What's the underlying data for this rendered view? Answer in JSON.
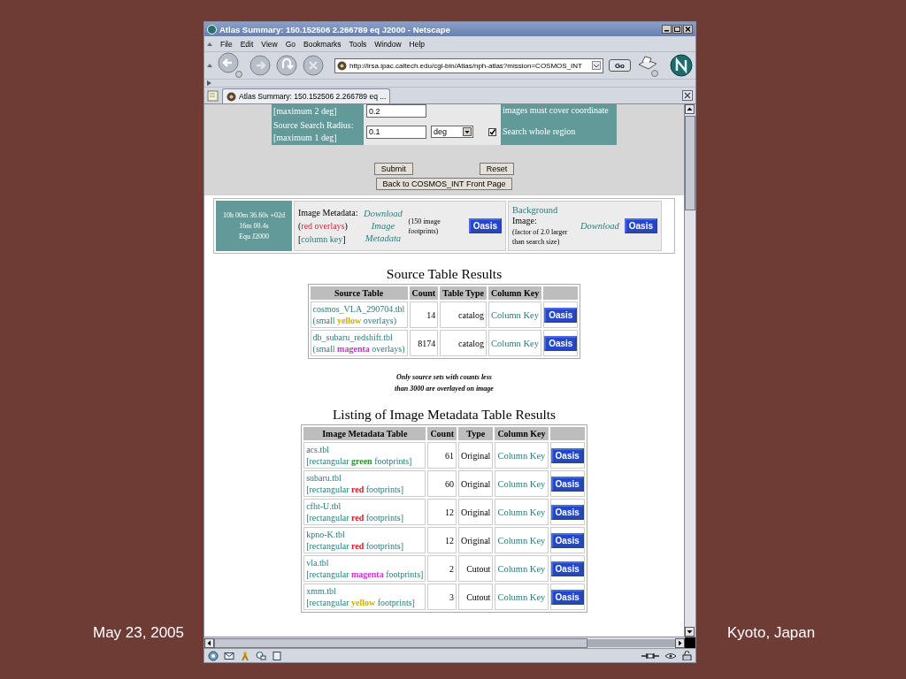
{
  "slide": {
    "date": "May 23, 2005",
    "place": "Kyoto, Japan"
  },
  "window": {
    "title": "Atlas Summary: 150.152506 2.266789 eq J2000 - Netscape",
    "menu": [
      "File",
      "Edit",
      "View",
      "Go",
      "Bookmarks",
      "Tools",
      "Window",
      "Help"
    ],
    "address": "http://irsa.ipac.caltech.edu/cgi-bin/Atlas/nph-atlas?mission=COSMOS_INT",
    "go": "Go",
    "tab": "Atlas Summary: 150.152506 2.266789 eq ..."
  },
  "search_form": {
    "rows": [
      {
        "label_lines": [
          "[maximum 2 deg]"
        ],
        "value": "0.2",
        "note": "images must cover coordinate"
      },
      {
        "label_lines": [
          "Source Search Radius:",
          "[maximum 1 deg]"
        ],
        "value": "0.1",
        "unit": "deg",
        "checked": true,
        "note": "Search whole region"
      }
    ],
    "buttons": [
      "Submit",
      "Reset"
    ],
    "back_button": "Back to COSMOS_INT Front Page"
  },
  "position": {
    "coordinates": "10h 00m 36.60s +02d 16m 00.4s",
    "system": "Equ J2000"
  },
  "image_metadata": {
    "label": "Image Metadata:",
    "overlay": [
      "(",
      "red overlays",
      ")"
    ],
    "column_key": [
      "[",
      "column key",
      "]"
    ],
    "download": "Download Image Metadata",
    "footprints": "(150 image footprints)",
    "oasis": "Oasis"
  },
  "background": {
    "link": "Background",
    "label": "Image:",
    "note": "(factor of 2.0 larger than search size)",
    "download": "Download",
    "oasis": "Oasis"
  },
  "source_table": {
    "title": "Source Table Results",
    "columns": [
      "Source Table",
      "Count",
      "Table Type",
      "Column Key"
    ],
    "rows": [
      {
        "name": "cosmos_VLA_290704.tbl",
        "note": "(small **yellow** overlays)",
        "color": "#c8b400",
        "count": "14",
        "type": "catalog",
        "column_key": "Column Key",
        "oasis": "Oasis"
      },
      {
        "name": "db_subaru_redshift.tbl",
        "note": "(small **magenta** overlays)",
        "color": "#cc33cc",
        "count": "8174",
        "type": "catalog",
        "column_key": "Column Key",
        "oasis": "Oasis"
      }
    ]
  },
  "overlay_note": [
    "Only source sets with counts less",
    "than 3000 are overlayed on image"
  ],
  "metadata_table": {
    "title": "Listing of Image Metadata Table Results",
    "columns": [
      "Image Metadata Table",
      "Count",
      "Type",
      "Column Key"
    ],
    "rows": [
      {
        "name": "acs.tbl",
        "note": "[rectangular **green** footprints]",
        "color": "#2e8b2e",
        "count": "61",
        "type": "Original",
        "column_key": "Column Key",
        "oasis": "Oasis"
      },
      {
        "name": "subaru.tbl",
        "note": "[rectangular **red** footprints]",
        "color": "#cc2222",
        "count": "60",
        "type": "Original",
        "column_key": "Column Key",
        "oasis": "Oasis"
      },
      {
        "name": "cfht-U.tbl",
        "note": "[rectangular **red** footprints]",
        "color": "#cc2222",
        "count": "12",
        "type": "Original",
        "column_key": "Column Key",
        "oasis": "Oasis"
      },
      {
        "name": "kpno-K.tbl",
        "note": "[rectangular **red** footprints]",
        "color": "#cc2222",
        "count": "12",
        "type": "Original",
        "column_key": "Column Key",
        "oasis": "Oasis"
      },
      {
        "name": "vla.tbl",
        "note": "[rectangular **magenta** footprints]",
        "color": "#cc33cc",
        "count": "2",
        "type": "Cutout",
        "column_key": "Column Key",
        "oasis": "Oasis"
      },
      {
        "name": "xmm.tbl",
        "note": "[rectangular **yellow** footprints]",
        "color": "#c8b400",
        "count": "3",
        "type": "Cutout",
        "column_key": "Column Key",
        "oasis": "Oasis"
      }
    ]
  }
}
